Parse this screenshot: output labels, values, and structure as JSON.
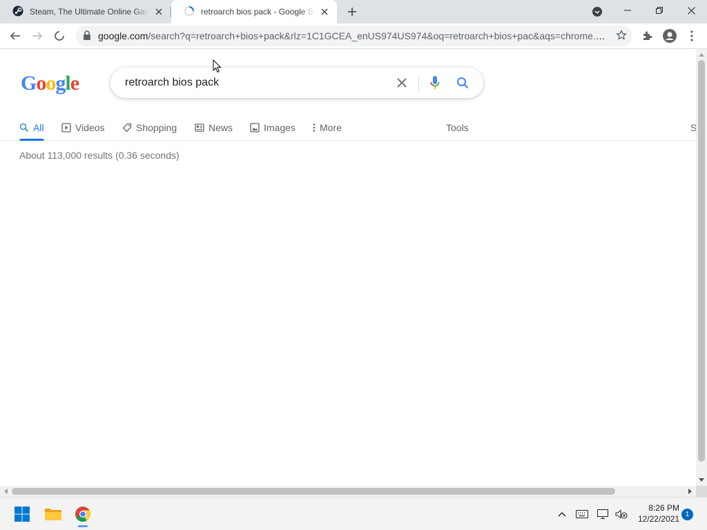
{
  "browser": {
    "tabs": [
      {
        "title": "Steam, The Ultimate Online Game Platform",
        "active": false
      },
      {
        "title": "retroarch bios pack - Google Search",
        "active": true
      }
    ],
    "url_host": "google.com",
    "url_rest": "/search?q=retroarch+bios+pack&rlz=1C1GCEA_enUS974US974&oq=retroarch+bios+pac&aqs=chrome.0...",
    "loading": true
  },
  "google": {
    "logo_letters": [
      "G",
      "o",
      "o",
      "g",
      "l",
      "e"
    ],
    "logo_colors": [
      "#4285f4",
      "#ea4335",
      "#fbbc05",
      "#4285f4",
      "#34a853",
      "#ea4335"
    ],
    "query": "retroarch bios pack",
    "tabs": [
      {
        "label": "All",
        "icon": "search-icon",
        "active": true
      },
      {
        "label": "Videos",
        "icon": "video-icon",
        "active": false
      },
      {
        "label": "Shopping",
        "icon": "tag-icon",
        "active": false
      },
      {
        "label": "News",
        "icon": "news-icon",
        "active": false
      },
      {
        "label": "Images",
        "icon": "image-icon",
        "active": false
      },
      {
        "label": "More",
        "icon": "more-vert-icon",
        "active": false
      }
    ],
    "tools_label": "Tools",
    "cutoff_label": "S",
    "result_stats": "About 113,000 results (0.36 seconds)"
  },
  "taskbar": {
    "apps": [
      {
        "name": "Start",
        "icon": "windows-start-icon"
      },
      {
        "name": "File Explorer",
        "icon": "folder-icon"
      },
      {
        "name": "Google Chrome",
        "icon": "chrome-icon",
        "running": true
      }
    ],
    "time": "8:26 PM",
    "date": "12/22/2021",
    "notification_count": "1"
  },
  "colors": {
    "accent": "#1a73e8",
    "tab_strip": "#dee1e6",
    "omnibox_bg": "#f1f3f4"
  }
}
